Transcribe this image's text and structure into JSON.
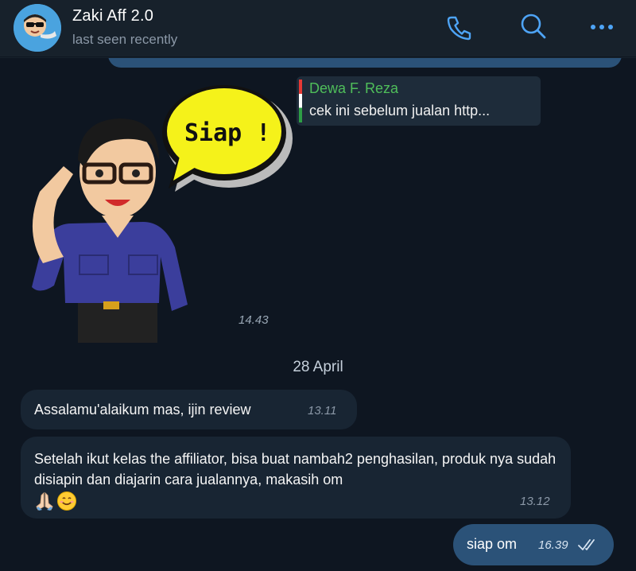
{
  "header": {
    "title": "Zaki Aff 2.0",
    "status": "last seen recently",
    "icons": [
      "phone-icon",
      "search-icon",
      "more-icon"
    ],
    "accent": "#4ea4f6"
  },
  "messages": {
    "sticker": {
      "text": "Siap !",
      "time": "14.43",
      "reply": {
        "name": "Dewa F. Reza",
        "text": "cek ini sebelum jualan http..."
      }
    },
    "date_divider": "28 April",
    "incoming": [
      {
        "text": "Assalamu'alaikum mas, ijin review",
        "time": "13.11"
      },
      {
        "text": "Setelah ikut kelas the affiliator, bisa buat nambah2 penghasilan, produk nya sudah disiapin dan diajarin cara jualannya, makasih om",
        "emojis": [
          "pray-emoji",
          "smile-emoji"
        ],
        "time": "13.12"
      }
    ],
    "outgoing": [
      {
        "text": "siap om",
        "time": "16.39",
        "status": "read"
      }
    ]
  },
  "colors": {
    "background": "#0e1621",
    "header": "#17212b",
    "incoming_bubble": "#182533",
    "outgoing_bubble": "#2b5278",
    "reply_name": "#4fbe5a"
  }
}
